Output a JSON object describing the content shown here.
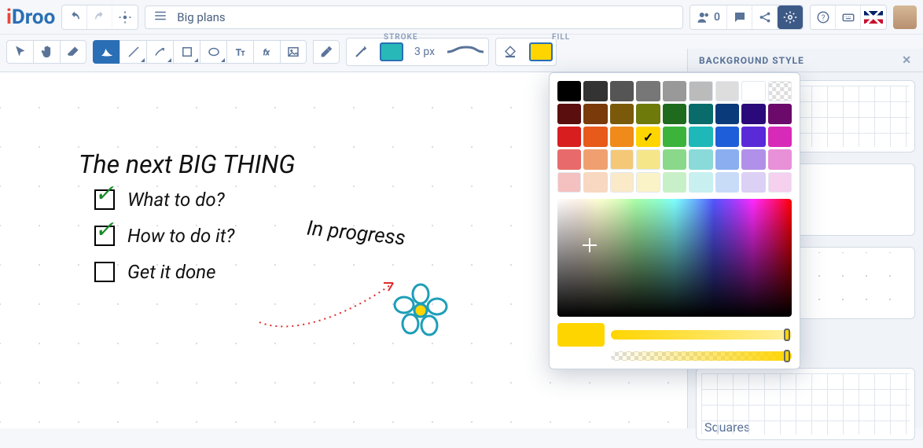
{
  "app": {
    "name_prefix": "i",
    "name_rest": "Droo"
  },
  "header": {
    "board_title": "Big plans",
    "users_count": "0"
  },
  "toolbar": {
    "stroke_label": "STROKE",
    "fill_label": "FILL",
    "stroke_width": "3 px",
    "stroke_color": "#28b8b8",
    "fill_color": "#ffd500"
  },
  "panel": {
    "title": "BACKGROUND STYLE",
    "option_squares": "Squares",
    "accent_swatches": [
      "#d9f5d9",
      "#d9f0ff",
      "#ffe9e0",
      "#e8dbff"
    ]
  },
  "canvas": {
    "title": "The next BIG THING",
    "items": [
      {
        "text": "What to do?",
        "checked": true
      },
      {
        "text": "How to do it?",
        "checked": true
      },
      {
        "text": "Get it done",
        "checked": false
      }
    ],
    "annotation": "In progress"
  },
  "picker": {
    "selected": "#ffd500",
    "rows": [
      [
        "#000000",
        "#333333",
        "#555555",
        "#777777",
        "#999999",
        "#bbbbbb",
        "#dddddd",
        "#ffffff",
        "transparent"
      ],
      [
        "#5a0e0e",
        "#7a3a0a",
        "#7a5a0a",
        "#6e7a0a",
        "#1e6b1e",
        "#0a6b6b",
        "#0a3a7a",
        "#2a0a7a",
        "#6b0a6b"
      ],
      [
        "#d81e1e",
        "#e85a1a",
        "#f08a1a",
        "#ffd500",
        "#3cb43c",
        "#1eb8b8",
        "#1e5ed8",
        "#5a2ad8",
        "#d82ab8"
      ],
      [
        "#e86a6a",
        "#f0a070",
        "#f5c878",
        "#f5e68a",
        "#8ad88a",
        "#8adada",
        "#8aaef0",
        "#b090e8",
        "#e890d8"
      ],
      [
        "#f5c0c0",
        "#f8d8c0",
        "#faeac8",
        "#faf3c8",
        "#c8f0c8",
        "#c8f0f0",
        "#c8dcf8",
        "#dcd0f5",
        "#f5d0ef"
      ]
    ]
  }
}
